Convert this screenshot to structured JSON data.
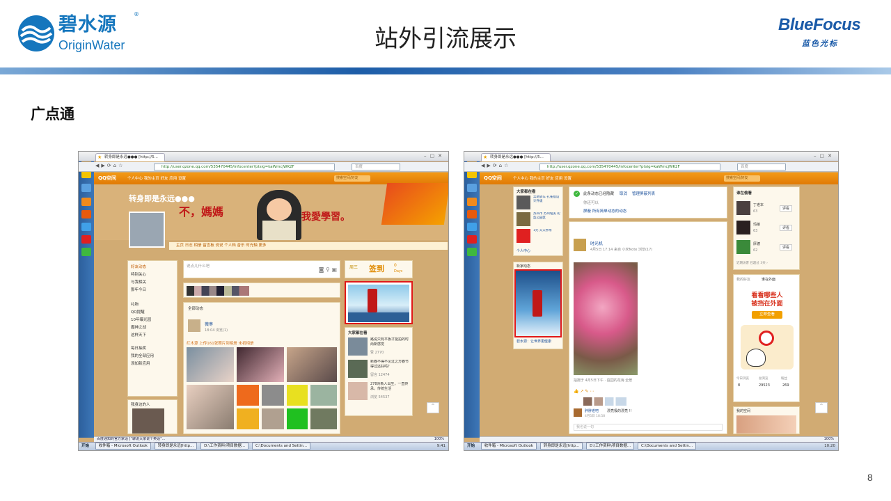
{
  "slide": {
    "title": "站外引流展示",
    "subtitle": "广点通",
    "page_number": "8",
    "accent_color": "#1576bd",
    "band_color": "#1d5da8"
  },
  "logo_left": {
    "name_cn": "碧水源",
    "name_en": "OriginWater",
    "mark": "®",
    "icon": "wave-logo-icon"
  },
  "logo_right": {
    "name_en": "BlueFocus",
    "name_cn": "蓝色光标"
  },
  "shot1": {
    "tab_title": "转身即是永远●●● [http://5...",
    "url": "http://user.qzone.qq.com/535470445/infocenter?ptsig=kaWmcjWK2F",
    "search_placeholder": "百度",
    "qzone_logo": "QQ空间",
    "qzone_menu": "个人中心   我的主页   好友   应用   设置",
    "qzone_search": "搜索空间/好友",
    "profile_name": "转身即是永远●●●",
    "banner_text_1": "不，媽媽",
    "banner_text_2": "我愛學習。",
    "nav_items": "主页   日志   相册   留言板   说说   个人档   音乐   时光轴   更多",
    "left_menu": [
      "好友动态",
      "特别关心",
      "与我相关",
      "那年今日",
      "礼物",
      "QQ提醒",
      "10年曝光园",
      "魔神之战",
      "这样天下",
      "每日抽奖",
      "我的全部应用",
      "添加新应用"
    ],
    "post_placeholder": "说点儿什么吧",
    "feed_header": "全部动态",
    "feed_user": "薇枣",
    "feed_meta": "18:04   浏览(1)",
    "feed_caption": "红木源 上传161张照片到相册 未初相册",
    "signin_day": "周三",
    "signin_label": "签到",
    "signin_count": "0",
    "signin_unit": "Days",
    "ad_label": "广点通广告",
    "recommend_title": "大家都在看",
    "recommend_items": [
      "路说只有平板才能拍的时尚新感觉",
      "新春不得不见过之万春节得过还好吗？",
      "278对新人出生，一直传承，传统生活"
    ],
    "recommend_stats": [
      "赞 2770",
      "留言 12474",
      "浏览 54537"
    ],
    "side_title": "我身边的人",
    "status_text": "百度通知的官方家话 [“聊说大家说个英话”...",
    "zoom": "100%",
    "taskbar_items": [
      "开始",
      "收件箱 - Microsoft Outlook",
      "转身即是永远[http...",
      "D:\\工作资料\\项目数据...",
      "C:\\Documents and Settin..."
    ],
    "clock": "9:41"
  },
  "shot2": {
    "tab_title": "转身即是永远●●● [http://5...",
    "url": "http://user.qzone.qq.com/535470445/infocenter?ptsig=kaWmcjWK2F",
    "search_placeholder": "百度",
    "qzone_logo": "QQ空间",
    "qzone_menu": "个人中心   我的主页   好友   应用   设置",
    "qzone_search": "搜索空间/好友",
    "left_title": "大家都在看",
    "left_items": [
      "奔驰轿车 孔雀版设计升级",
      "苏州市 苏州站美 轮奂公园区",
      "1元 天天秒杀"
    ],
    "left_footer": "个人中心",
    "ad_box_title": "新家动态",
    "ad_box_link": "碧水源：让世界更健康",
    "notice_1": "此条动态已经隐藏",
    "notice_action_1": "取消",
    "notice_action_2": "管理屏蔽列表",
    "notice_2": "你还可以",
    "notice_3": "屏蔽 所有简单动态的动态",
    "post_user": "时光机",
    "post_meta": "4月5日 17:14   来自 小米Note   浏览(17)",
    "post_footer": "拍摄于 4月5日下午 · 庭园的花海 全景",
    "comment_user": "胖胖老吧",
    "comment_text": "漂亮极的漂亮 !!",
    "comment_time": "4月5日 18:58",
    "comment_placeholder": "我也说一句",
    "right_title": "谁在偷看",
    "visitors": [
      {
        "name": "丁老本",
        "count": "63"
      },
      {
        "name": "玛丽",
        "count": "63"
      },
      {
        "name": "厚德",
        "count": "62"
      }
    ],
    "visitor_button": "评看",
    "visitor_footer": "近期访客 已超过 3天 ›",
    "promo_tabs": [
      "我的好友",
      "谁在外面"
    ],
    "promo_line_1": "看看哪些人",
    "promo_line_2": "被挡在外面",
    "promo_button": "立即查看",
    "stats_labels": [
      "今日浏览",
      "总浏览",
      "粉丝"
    ],
    "stats_values": [
      "8",
      "29523",
      "269"
    ],
    "side_title": "我的空间",
    "zoom": "100%",
    "taskbar_items": [
      "开始",
      "收件箱 - Microsoft Outlook",
      "转身即是永远[http...",
      "D:\\工作资料\\项目数据...",
      "C:\\Documents and Settin..."
    ],
    "clock": "10:20"
  }
}
